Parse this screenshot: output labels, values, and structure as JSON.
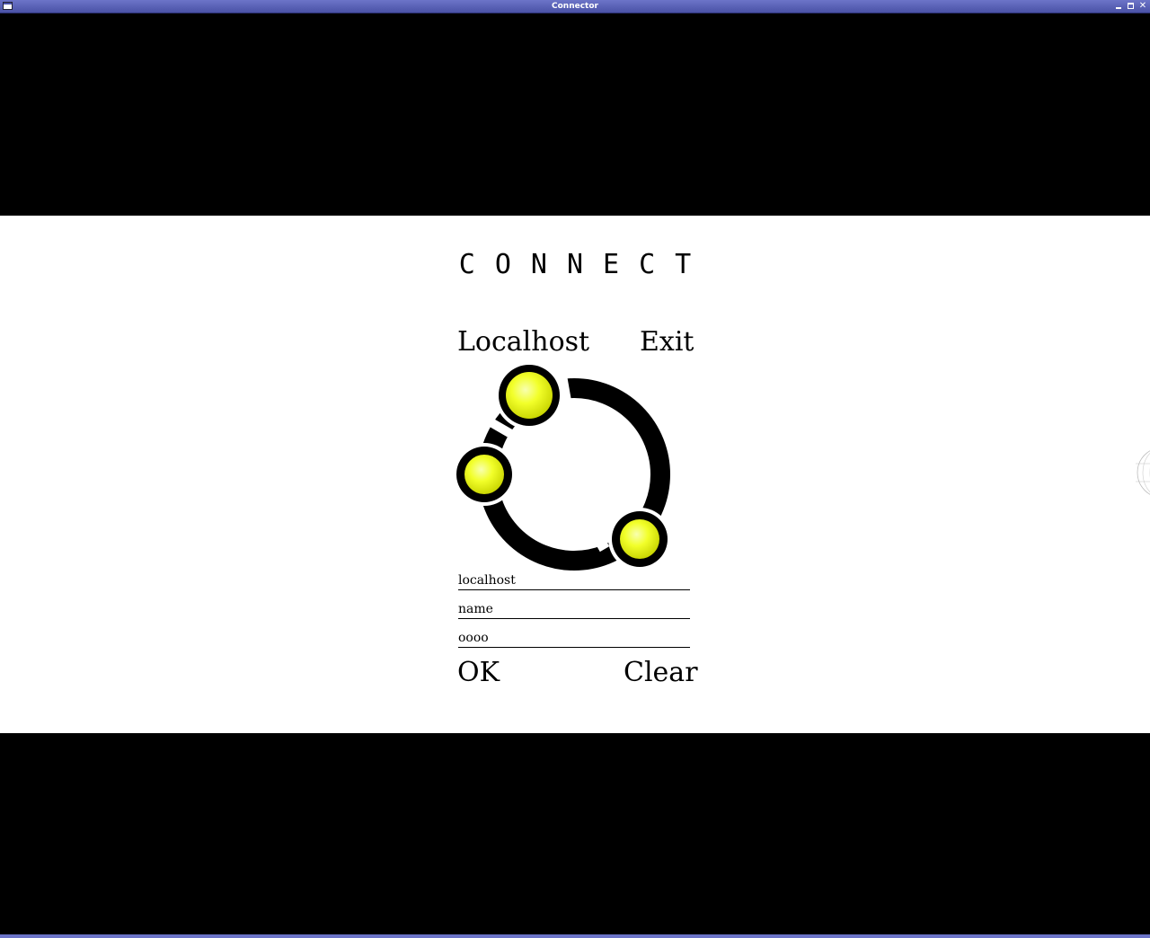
{
  "window": {
    "title": "Connector",
    "icons": {
      "app": "window-menu-icon",
      "minimize": "minimize-icon",
      "maximize": "maximize-icon",
      "close": "close-icon"
    }
  },
  "panel": {
    "heading": "CONNECT",
    "links": {
      "localhost": "Localhost",
      "exit": "Exit"
    },
    "logo": {
      "icon": "network-logo-icon",
      "accent": "#f2ff2a",
      "ring": "#000000"
    },
    "fields": {
      "host_value": "localhost",
      "name_value": "name",
      "password_value": "oooo"
    },
    "buttons": {
      "ok": "OK",
      "clear": "Clear"
    }
  },
  "colors": {
    "titlebar": "#5a62b8",
    "background": "#000000",
    "panel": "#ffffff"
  }
}
